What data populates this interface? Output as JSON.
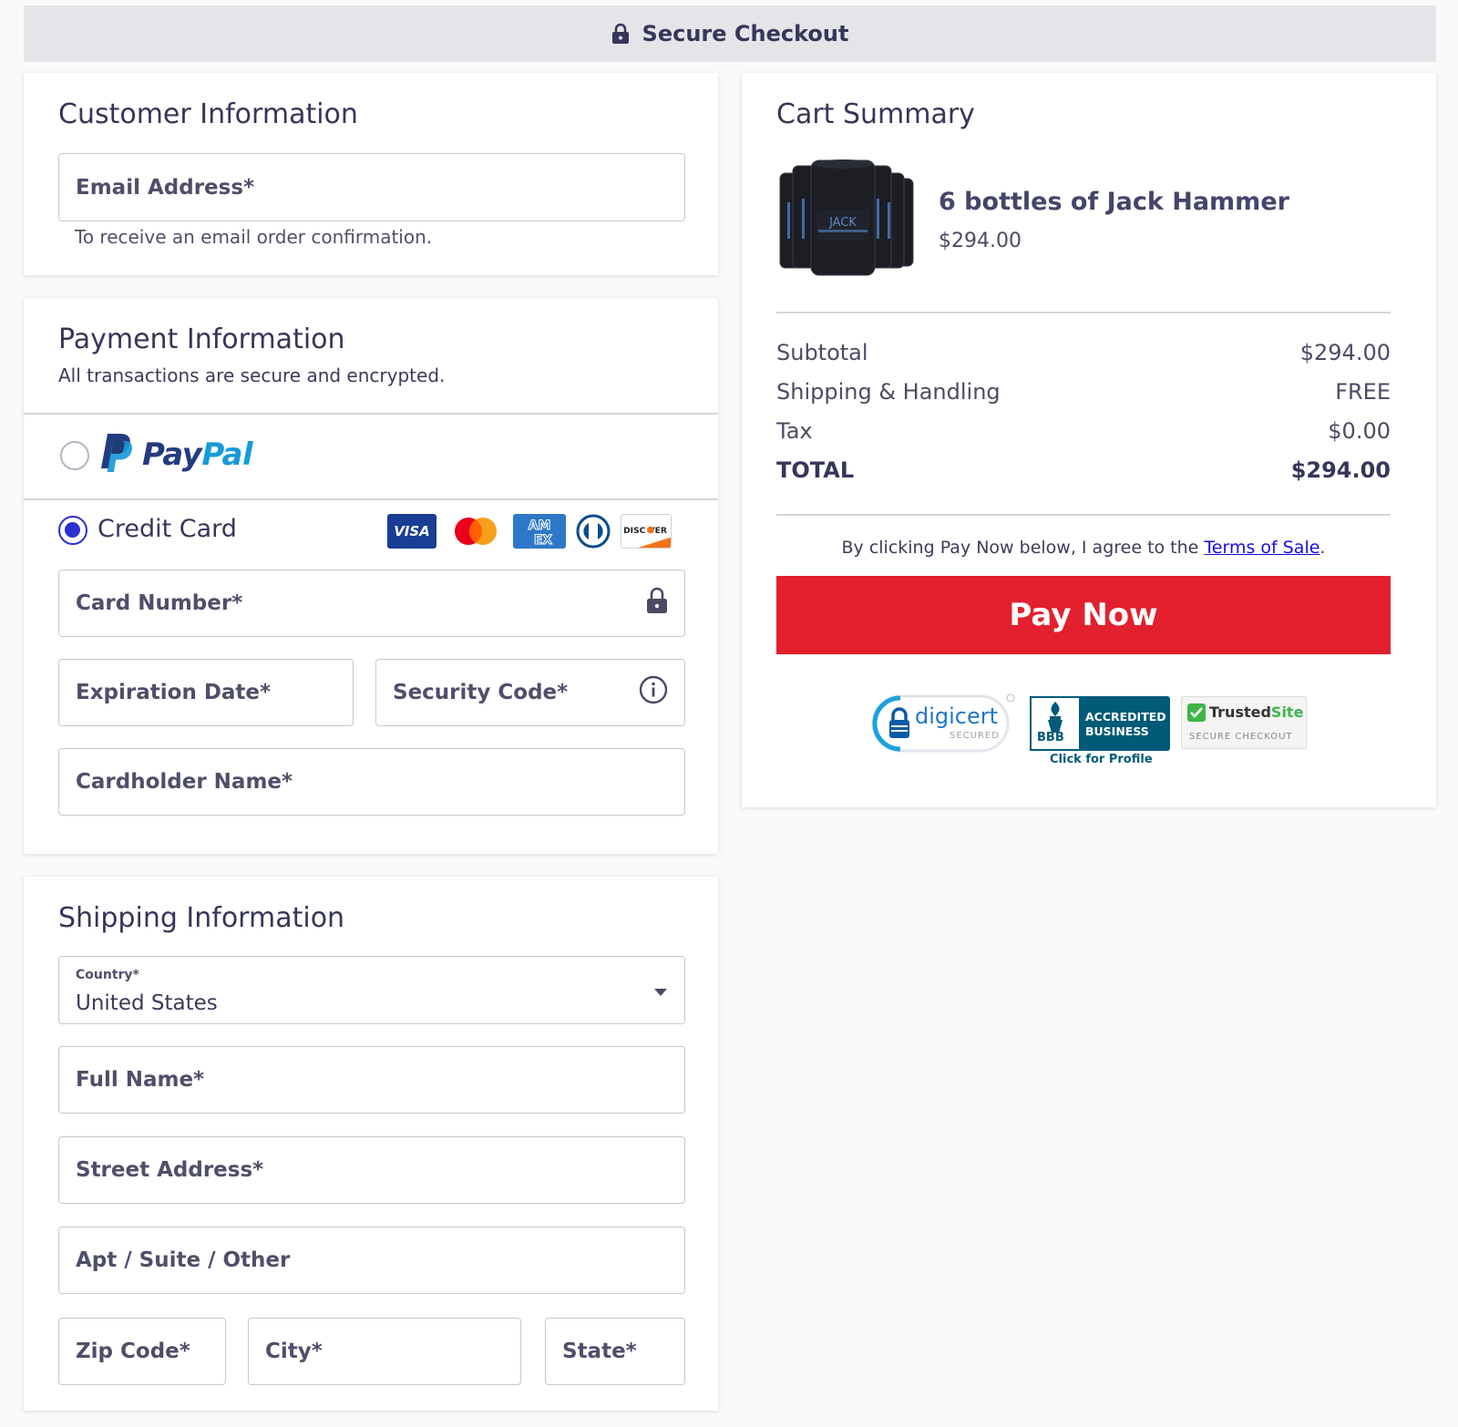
{
  "header": {
    "title": "Secure Checkout",
    "icon": "lock-icon"
  },
  "customer": {
    "title": "Customer Information",
    "email_placeholder": "Email Address*",
    "email_hint": "To receive an email order confirmation."
  },
  "payment": {
    "title": "Payment Information",
    "subtitle": "All transactions are secure and encrypted.",
    "paypal": {
      "word_pay": "Pay",
      "word_pal": "Pal",
      "selected": false
    },
    "credit_card": {
      "label": "Credit Card",
      "selected": true,
      "brands": [
        "VISA",
        "Mastercard",
        "AMEX",
        "Diners Club",
        "DISCOVER"
      ]
    },
    "card_number_placeholder": "Card Number*",
    "expiration_placeholder": "Expiration Date*",
    "security_code_placeholder": "Security Code*",
    "cardholder_placeholder": "Cardholder Name*"
  },
  "shipping": {
    "title": "Shipping Information",
    "country_label": "Country*",
    "country_value": "United States",
    "full_name_placeholder": "Full Name*",
    "street_placeholder": "Street Address*",
    "apt_placeholder": "Apt / Suite / Other",
    "zip_placeholder": "Zip Code*",
    "city_placeholder": "City*",
    "state_placeholder": "State*"
  },
  "cart": {
    "title": "Cart Summary",
    "product": {
      "name": "6 bottles of Jack Hammer",
      "price": "$294.00",
      "bottle_label": "JACK"
    },
    "rows": [
      {
        "label": "Subtotal",
        "value": "$294.00"
      },
      {
        "label": "Shipping & Handling",
        "value": "FREE"
      },
      {
        "label": "Tax",
        "value": "$0.00"
      }
    ],
    "total": {
      "label": "TOTAL",
      "value": "$294.00"
    },
    "terms_prefix": "By clicking Pay Now below, I agree to the ",
    "terms_link": "Terms of Sale",
    "terms_suffix": ".",
    "pay_button": "Pay Now"
  },
  "badges": {
    "digicert": {
      "name": "digicert",
      "sub": "SECURED"
    },
    "bbb": {
      "line1": "ACCREDITED",
      "line2": "BUSINESS",
      "logo": "BBB",
      "caption": "Click for Profile"
    },
    "trustedsite": {
      "name_a": "Trusted",
      "name_b": "Site",
      "sub": "SECURE CHECKOUT"
    }
  },
  "colors": {
    "accent": "#2d2fd1",
    "pay_button": "#e3202d",
    "link": "#1a0dde",
    "header_bg": "#e4e4e9"
  }
}
